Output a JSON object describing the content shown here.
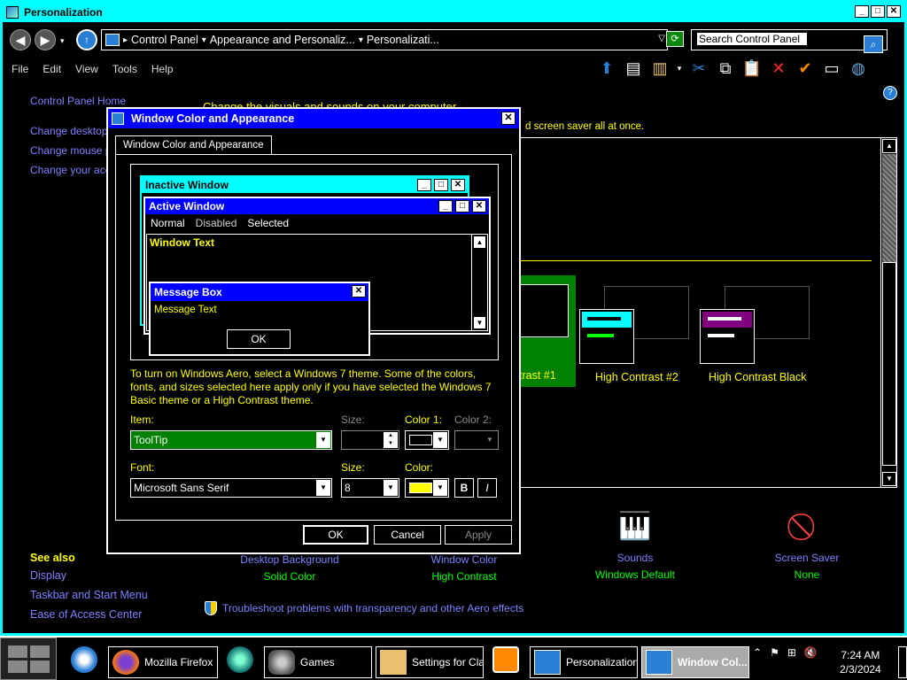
{
  "window": {
    "title": "Personalization",
    "controls": {
      "minimize": "_",
      "maximize": "□",
      "close": "✕"
    }
  },
  "address": {
    "crumbs": [
      "Control Panel",
      "Appearance and Personaliz...",
      "Personalizati..."
    ],
    "search_placeholder": "Search Control Panel"
  },
  "menu": [
    "File",
    "Edit",
    "View",
    "Tools",
    "Help"
  ],
  "left_nav": {
    "home": "Control Panel Home",
    "links": [
      "Change desktop ic",
      "Change mouse poi",
      "Change your acco"
    ]
  },
  "content": {
    "title": "Change the visuals and sounds on your computer",
    "subtitle": "d screen saver all at once."
  },
  "themes": [
    {
      "label": "trast #1",
      "selected": true
    },
    {
      "label": "High Contrast #2",
      "selected": false
    },
    {
      "label": "High Contrast Black",
      "selected": false
    }
  ],
  "see_also": {
    "heading": "See also",
    "links": [
      "Display",
      "Taskbar and Start Menu",
      "Ease of Access Center"
    ]
  },
  "bottom_items": [
    {
      "top": "Desktop Background",
      "sub": "Solid Color"
    },
    {
      "top": "Window Color",
      "sub": "High Contrast"
    },
    {
      "top": "Sounds",
      "sub": "Windows Default"
    },
    {
      "top": "Screen Saver",
      "sub": "None"
    }
  ],
  "troubleshoot": "Troubleshoot problems with transparency and other Aero effects",
  "dialog": {
    "title": "Window Color and Appearance",
    "tab": "Window Color and Appearance",
    "preview": {
      "inactive_title": "Inactive Window",
      "active_title": "Active Window",
      "menu": [
        "Normal",
        "Disabled",
        "Selected"
      ],
      "window_text": "Window Text",
      "msgbox_title": "Message Box",
      "msgbox_text": "Message Text",
      "ok": "OK"
    },
    "info": "To turn on Windows Aero, select a Windows 7 theme.  Some of the colors, fonts, and sizes selected here apply only if you have selected the Windows 7 Basic theme or a High Contrast theme.",
    "item_label": "Item:",
    "item_value": "ToolTip",
    "size_label": "Size:",
    "color1_label": "Color 1:",
    "color2_label": "Color 2:",
    "font_label": "Font:",
    "font_value": "Microsoft Sans Serif",
    "font_size_label": "Size:",
    "font_size_value": "8",
    "font_color_label": "Color:",
    "bold": "B",
    "italic": "I",
    "buttons": {
      "ok": "OK",
      "cancel": "Cancel",
      "apply": "Apply"
    },
    "colors": {
      "color1": "#000000",
      "font_color": "#ffff00"
    }
  },
  "taskbar": {
    "items": [
      {
        "label": "Mozilla Firefox"
      },
      {
        "label": "Games"
      },
      {
        "label": "Settings for Cla..."
      },
      {
        "label": "Personalization"
      },
      {
        "label": "Window Col..."
      }
    ],
    "time": "7:24 AM",
    "date": "2/3/2024"
  },
  "colors": {
    "accent_cyan": "#00ffff",
    "active_title": "#0000ff",
    "text_yellow": "#ffff00",
    "link_purple": "#8080ff",
    "sub_green": "#00ff00",
    "selected_green": "#008000"
  }
}
